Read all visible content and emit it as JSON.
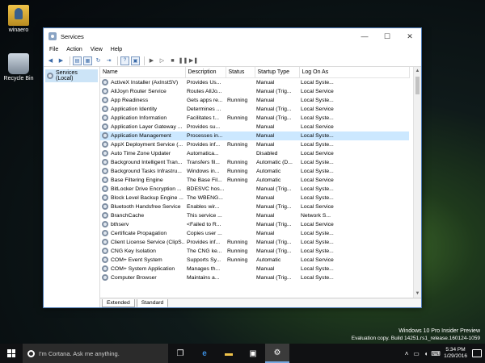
{
  "desktop": {
    "icons": [
      {
        "label": "winaero",
        "icon": "user-folder-icon"
      },
      {
        "label": "Recycle Bin",
        "icon": "recycle-bin-icon"
      }
    ],
    "watermark": {
      "line1": "Windows 10 Pro Insider Preview",
      "line2": "Evaluation copy. Build 14251.rs1_release.160124-1059"
    }
  },
  "window": {
    "title": "Services",
    "controls": {
      "minimize": "—",
      "maximize": "☐",
      "close": "✕"
    },
    "menu": [
      "File",
      "Action",
      "View",
      "Help"
    ],
    "tree": {
      "label": "Services (Local)"
    },
    "columns": [
      "Name",
      "Description",
      "Status",
      "Startup Type",
      "Log On As"
    ],
    "rows": [
      {
        "name": "ActiveX Installer (AxInstSV)",
        "desc": "Provides Us...",
        "status": "",
        "startup": "Manual",
        "logon": "Local Syste..."
      },
      {
        "name": "AllJoyn Router Service",
        "desc": "Routes AllJo...",
        "status": "",
        "startup": "Manual (Trig...",
        "logon": "Local Service"
      },
      {
        "name": "App Readiness",
        "desc": "Gets apps re...",
        "status": "Running",
        "startup": "Manual",
        "logon": "Local Syste..."
      },
      {
        "name": "Application Identity",
        "desc": "Determines ...",
        "status": "",
        "startup": "Manual (Trig...",
        "logon": "Local Service"
      },
      {
        "name": "Application Information",
        "desc": "Facilitates t...",
        "status": "Running",
        "startup": "Manual (Trig...",
        "logon": "Local Syste..."
      },
      {
        "name": "Application Layer Gateway ...",
        "desc": "Provides su...",
        "status": "",
        "startup": "Manual",
        "logon": "Local Service"
      },
      {
        "name": "Application Management",
        "desc": "Processes in...",
        "status": "",
        "startup": "Manual",
        "logon": "Local Syste..."
      },
      {
        "name": "AppX Deployment Service (...",
        "desc": "Provides inf...",
        "status": "Running",
        "startup": "Manual",
        "logon": "Local Syste..."
      },
      {
        "name": "Auto Time Zone Updater",
        "desc": "Automatica...",
        "status": "",
        "startup": "Disabled",
        "logon": "Local Service"
      },
      {
        "name": "Background Intelligent Tran...",
        "desc": "Transfers fil...",
        "status": "Running",
        "startup": "Automatic (D...",
        "logon": "Local Syste..."
      },
      {
        "name": "Background Tasks Infrastru...",
        "desc": "Windows in...",
        "status": "Running",
        "startup": "Automatic",
        "logon": "Local Syste..."
      },
      {
        "name": "Base Filtering Engine",
        "desc": "The Base Fil...",
        "status": "Running",
        "startup": "Automatic",
        "logon": "Local Service"
      },
      {
        "name": "BitLocker Drive Encryption ...",
        "desc": "BDESVC hos...",
        "status": "",
        "startup": "Manual (Trig...",
        "logon": "Local Syste..."
      },
      {
        "name": "Block Level Backup Engine ...",
        "desc": "The WBENG...",
        "status": "",
        "startup": "Manual",
        "logon": "Local Syste..."
      },
      {
        "name": "Bluetooth Handsfree Service",
        "desc": "Enables wir...",
        "status": "",
        "startup": "Manual (Trig...",
        "logon": "Local Service"
      },
      {
        "name": "BranchCache",
        "desc": "This service ...",
        "status": "",
        "startup": "Manual",
        "logon": "Network S..."
      },
      {
        "name": "bthserv",
        "desc": "<Failed to R...",
        "status": "",
        "startup": "Manual (Trig...",
        "logon": "Local Service"
      },
      {
        "name": "Certificate Propagation",
        "desc": "Copies user ...",
        "status": "",
        "startup": "Manual",
        "logon": "Local Syste..."
      },
      {
        "name": "Client License Service (ClipS...",
        "desc": "Provides inf...",
        "status": "Running",
        "startup": "Manual (Trig...",
        "logon": "Local Syste..."
      },
      {
        "name": "CNG Key Isolation",
        "desc": "The CNG ke...",
        "status": "Running",
        "startup": "Manual (Trig...",
        "logon": "Local Syste..."
      },
      {
        "name": "COM+ Event System",
        "desc": "Supports Sy...",
        "status": "Running",
        "startup": "Automatic",
        "logon": "Local Service"
      },
      {
        "name": "COM+ System Application",
        "desc": "Manages th...",
        "status": "",
        "startup": "Manual",
        "logon": "Local Syste..."
      },
      {
        "name": "Computer Browser",
        "desc": "Maintains a...",
        "status": "",
        "startup": "Manual (Trig...",
        "logon": "Local Syste..."
      }
    ],
    "tabs": [
      "Extended",
      "Standard"
    ],
    "active_tab": "Standard"
  },
  "taskbar": {
    "search_placeholder": "I'm Cortana. Ask me anything.",
    "apps": [
      "task-view-icon",
      "edge-icon",
      "file-explorer-icon",
      "store-icon",
      "services-icon"
    ],
    "clock_time": "5:34 PM",
    "clock_date": "1/29/2016"
  },
  "colors": {
    "accent": "#4a79b5",
    "selection": "#cce8ff",
    "taskbar": "#101113"
  }
}
